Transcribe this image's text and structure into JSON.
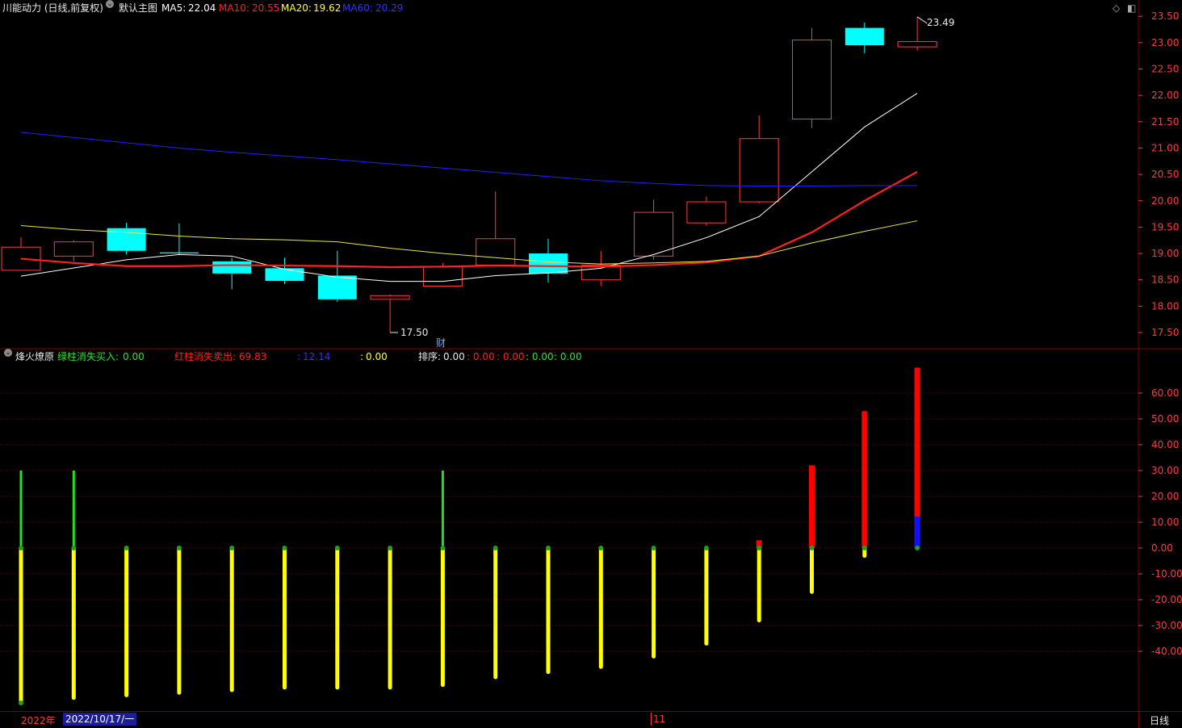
{
  "main_header": {
    "title": "川能动力 (日线,前复权)",
    "template": "默认主图",
    "ma5": {
      "label": "MA5:",
      "value": "22.04",
      "color": "#ffffff"
    },
    "ma10": {
      "label": "MA10:",
      "value": "20.55",
      "color": "#ff2020"
    },
    "ma20": {
      "label": "MA20:",
      "value": "19.62",
      "color": "#ffff40"
    },
    "ma60": {
      "label": "MA60:",
      "value": "20.29",
      "color": "#2020ff"
    }
  },
  "indicator_header": {
    "name": "烽火燎原",
    "green_label": "绿柱消失买入:",
    "green_value": "0.00",
    "red_label": "红柱消失卖出:",
    "red_value": "69.83",
    "blue_label": ":",
    "blue_value": "12.14",
    "yellow_label": ":",
    "yellow_value": "0.00",
    "sort_label": "排序:",
    "sort_value": "0.00",
    "extra": [
      ": 0.00",
      ": 0.00",
      ": 0.00",
      ": 0.00"
    ]
  },
  "annotations": {
    "high": "23.49",
    "low": "17.50",
    "fin_marker": "财"
  },
  "bottom_bar": {
    "year": "2022年",
    "date": "2022/10/17/一",
    "month": "11",
    "period": "日线"
  },
  "colors": {
    "up": "#ff3b3b",
    "down": "#00ffff",
    "grid": "#7a0000",
    "axis_text": "#ff3b3b"
  },
  "chart_data": {
    "type": "candlestick",
    "price_ticks": [
      "23.50",
      "23.00",
      "22.50",
      "22.00",
      "21.50",
      "21.00",
      "20.50",
      "20.00",
      "19.50",
      "19.00",
      "18.50",
      "18.00",
      "17.50"
    ],
    "price_range": [
      17.25,
      23.6
    ],
    "candles": [
      {
        "o": 18.68,
        "h": 19.31,
        "l": 18.68,
        "c": 19.12
      },
      {
        "o": 18.95,
        "h": 19.25,
        "l": 18.85,
        "c": 19.22
      },
      {
        "o": 19.48,
        "h": 19.58,
        "l": 18.98,
        "c": 19.05
      },
      {
        "o": 19.02,
        "h": 19.57,
        "l": 18.98,
        "c": 19.0
      },
      {
        "o": 18.85,
        "h": 18.92,
        "l": 18.32,
        "c": 18.62
      },
      {
        "o": 18.72,
        "h": 18.92,
        "l": 18.42,
        "c": 18.48
      },
      {
        "o": 18.58,
        "h": 19.05,
        "l": 18.08,
        "c": 18.13
      },
      {
        "o": 18.13,
        "h": 18.22,
        "l": 17.5,
        "c": 18.2
      },
      {
        "o": 18.38,
        "h": 18.82,
        "l": 18.38,
        "c": 18.75
      },
      {
        "o": 18.78,
        "h": 20.18,
        "l": 18.78,
        "c": 19.28
      },
      {
        "o": 19.0,
        "h": 19.28,
        "l": 18.45,
        "c": 18.62
      },
      {
        "o": 18.5,
        "h": 19.05,
        "l": 18.38,
        "c": 18.78
      },
      {
        "o": 18.95,
        "h": 20.02,
        "l": 18.88,
        "c": 19.78
      },
      {
        "o": 19.58,
        "h": 20.08,
        "l": 19.52,
        "c": 19.98
      },
      {
        "o": 19.98,
        "h": 21.62,
        "l": 19.95,
        "c": 21.18
      },
      {
        "o": 21.55,
        "h": 23.28,
        "l": 21.38,
        "c": 23.05
      },
      {
        "o": 23.28,
        "h": 23.38,
        "l": 22.8,
        "c": 22.95
      },
      {
        "o": 22.92,
        "h": 23.49,
        "l": 22.85,
        "c": 23.02
      }
    ],
    "series": [
      {
        "name": "MA5",
        "values": [
          18.57,
          null,
          18.88,
          18.98,
          18.95,
          18.7,
          18.55,
          18.47,
          18.47,
          18.58,
          18.63,
          18.72,
          18.98,
          19.3,
          19.7,
          20.55,
          21.4,
          22.04
        ]
      },
      {
        "name": "MA10",
        "values": [
          18.9,
          18.82,
          18.76,
          18.76,
          18.78,
          18.77,
          18.76,
          18.74,
          18.75,
          18.77,
          18.76,
          18.75,
          18.78,
          18.83,
          18.95,
          19.4,
          20.0,
          20.55
        ]
      },
      {
        "name": "MA20",
        "values": [
          19.53,
          19.45,
          19.4,
          19.33,
          19.28,
          19.26,
          19.22,
          19.1,
          19.0,
          18.92,
          18.84,
          18.8,
          18.82,
          18.85,
          18.95,
          19.2,
          19.42,
          19.62
        ]
      },
      {
        "name": "MA60",
        "values": [
          21.3,
          21.2,
          21.1,
          21.0,
          20.92,
          20.85,
          20.78,
          20.7,
          20.62,
          20.54,
          20.46,
          20.38,
          20.33,
          20.29,
          20.28,
          20.28,
          20.29,
          20.29
        ]
      }
    ],
    "indicator": {
      "ticks": [
        "60.00",
        "50.00",
        "40.00",
        "30.00",
        "20.00",
        "10.00",
        "0.00",
        "-10.00",
        "-20.00",
        "-30.00",
        "-40.00"
      ],
      "range": [
        -62,
        70
      ],
      "yellow": [
        -60,
        -58,
        -57,
        -56,
        -55,
        -54,
        -54,
        -54,
        -53,
        -50,
        -48,
        -46,
        -42,
        -37,
        -28,
        -17,
        -3,
        0
      ],
      "green": [
        30,
        30,
        0,
        0,
        0,
        0,
        0,
        0,
        30,
        0,
        0,
        0,
        0,
        0,
        0,
        0,
        0,
        0
      ],
      "red": [
        0,
        0,
        0,
        0,
        0,
        0,
        0,
        0,
        0,
        0,
        0,
        0,
        0,
        0,
        3,
        32,
        53,
        69.83
      ],
      "blue": [
        0,
        0,
        0,
        0,
        0,
        0,
        0,
        0,
        0,
        0,
        0,
        0,
        0,
        0,
        0,
        0,
        0,
        12.14
      ]
    }
  }
}
